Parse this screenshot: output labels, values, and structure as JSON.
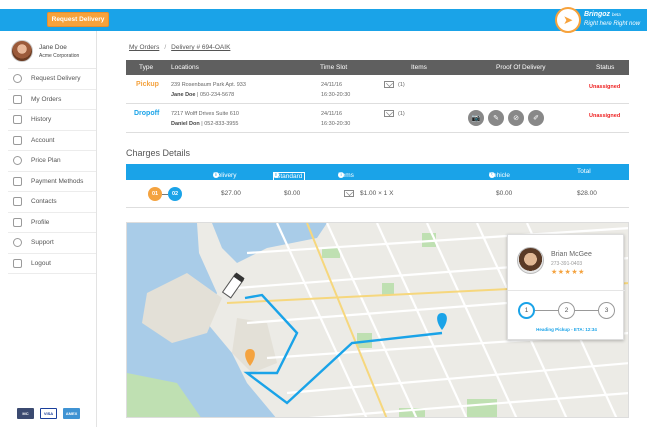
{
  "header": {
    "request_button": "Request Delivery",
    "brand_name": "Bringoz",
    "brand_suffix": "beta",
    "brand_tagline": "Right here Right now"
  },
  "user": {
    "name": "Jane Doe",
    "company": "Acme Corporation"
  },
  "nav": [
    {
      "label": "Request Delivery",
      "icon": "plus-circle-icon"
    },
    {
      "label": "My Orders",
      "icon": "orders-icon"
    },
    {
      "label": "History",
      "icon": "history-icon"
    },
    {
      "label": "Account",
      "icon": "account-icon"
    },
    {
      "label": "Price Plan",
      "icon": "price-plan-icon"
    },
    {
      "label": "Payment Methods",
      "icon": "credit-card-icon"
    },
    {
      "label": "Contacts",
      "icon": "contacts-icon"
    },
    {
      "label": "Profile",
      "icon": "profile-icon"
    },
    {
      "label": "Support",
      "icon": "support-icon"
    },
    {
      "label": "Logout",
      "icon": "logout-icon"
    }
  ],
  "payment_cards": [
    "MC",
    "VISA",
    "AMEX"
  ],
  "breadcrumb": {
    "root": "My Orders",
    "current": "Delivery # 694-OAIK",
    "separator": "/"
  },
  "orders": {
    "headers": [
      "Type",
      "Locations",
      "Time Slot",
      "Items",
      "Proof Of Delivery",
      "Status"
    ],
    "rows": [
      {
        "type": "Pickup",
        "address": "239 Rosenbaum Park Apt. 933",
        "contact_name": "Jane Doe",
        "contact_phone": "| 050-234-5678",
        "date": "24/11/16",
        "time": "16:30-20:30",
        "items": "(1)",
        "status": "Unassigned"
      },
      {
        "type": "Dropoff",
        "address": "7217 Wolff Drives Suite 610",
        "contact_name": "Daniel Don",
        "contact_phone": "| 052-833-3955",
        "date": "24/11/16",
        "time": "16:30-20:30",
        "items": "(1)",
        "status": "Unassigned"
      }
    ]
  },
  "charges": {
    "title": "Charges Details",
    "headers": {
      "delivery": "Delivery",
      "standard": "Standard",
      "items": "Items",
      "vehicle": "Vehicle",
      "total": "Total"
    },
    "row": {
      "step_from": "01",
      "step_to": "02",
      "delivery": "$27.00",
      "standard": "$0.00",
      "items": "$1.00 × 1 X",
      "vehicle": "$0.00",
      "total": "$28.00"
    }
  },
  "driver": {
    "name": "Brian McGee",
    "phone": "273-391-0403",
    "rating": "★★★★★",
    "steps": [
      "1",
      "2",
      "3"
    ],
    "status": "Heading Pickup - ETA: 12:34"
  },
  "colors": {
    "primary": "#1aa3e8",
    "accent": "#f4a340",
    "status_red": "#e22222",
    "table_header": "#5f5f5f"
  }
}
